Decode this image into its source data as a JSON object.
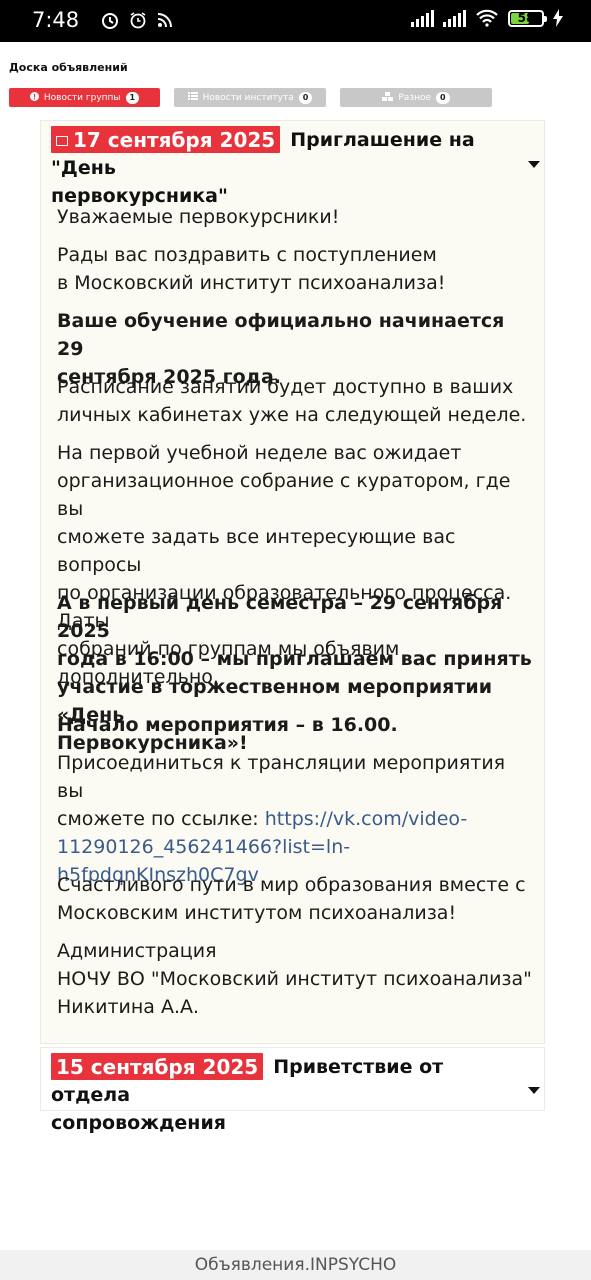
{
  "status_bar": {
    "time": "7:48",
    "battery": "58"
  },
  "board": {
    "title": "Доска объявлений",
    "tabs": [
      {
        "label": "Новости группы",
        "count": "1",
        "active": true
      },
      {
        "label": "Новости института",
        "count": "0",
        "active": false
      },
      {
        "label": "Разное",
        "count": "0",
        "active": false
      }
    ]
  },
  "announcements": [
    {
      "date": "17 сентября 2025",
      "title_line1": "Приглашение на \"День",
      "title_line2": "первокурсника\"",
      "expanded": true,
      "body": {
        "p1": "Уважаемые первокурсники!",
        "p2_l1": "Рады вас поздравить с поступлением",
        "p2_l2": "в Московский институт психоанализа!",
        "p3_l1": "Ваше обучение официально начинается 29",
        "p3_l2": "сентября 2025 года.",
        "p4_l1": "Расписание занятий будет доступно в ваших",
        "p4_l2": "личных кабинетах уже на следующей неделе.",
        "p5_l1": "На первой учебной неделе вас ожидает",
        "p5_l2": "организационное собрание с куратором, где вы",
        "p5_l3": "сможете задать все интересующие вас вопросы",
        "p5_l4": "по организации образовательного процесса. Даты",
        "p5_l5": "собраний по группам мы объявим дополнительно.",
        "p6_l1": "А в первый день семестра – 29 сентября 2025",
        "p6_l2": "года в 16:00 – мы приглашаем вас принять",
        "p6_l3": "участие в торжественном мероприятии «День",
        "p6_l4": "Первокурсника»!",
        "p7": "Начало мероприятия – в 16.00.",
        "p8_l1": "Присоединиться к трансляции мероприятия вы",
        "p8_l2_prefix": "сможете по ссылке: ",
        "link_l1": "https://vk.com/video-",
        "link_l2": "11290126_456241466?list=ln-",
        "link_l3": "h5fpdqnKInszh0C7gv",
        "p9_l1": "Счастливого пути в мир образования вместе с",
        "p9_l2": "Московским институтом психоанализа!",
        "sig_l1": "Администрация",
        "sig_l2": "НОЧУ ВО \"Московский институт психоанализа\"",
        "sig_l3": "Никитина А.А."
      }
    },
    {
      "date": "15 сентября 2025",
      "title_line1": "Приветствие от отдела",
      "title_line2": "сопровождения",
      "expanded": false
    }
  ],
  "footer": {
    "label": "Объявления.INPSYCHO"
  }
}
